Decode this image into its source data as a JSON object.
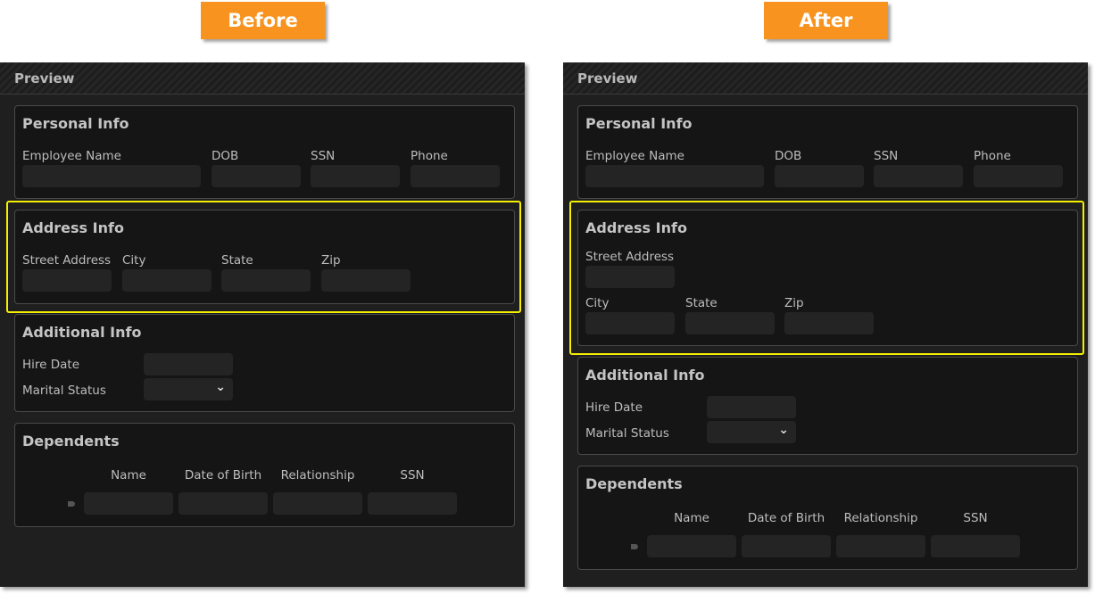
{
  "labels": {
    "before": "Before",
    "after": "After"
  },
  "colors": {
    "tag": "#f7931e",
    "highlight": "#f4f000",
    "panel": "#1f1f1f",
    "input": "#242424"
  },
  "panel": {
    "title": "Preview",
    "personal": {
      "title": "Personal Info",
      "fields": [
        "Employee Name",
        "DOB",
        "SSN",
        "Phone"
      ]
    },
    "address": {
      "title": "Address Info",
      "fields": [
        "Street Address",
        "City",
        "State",
        "Zip"
      ]
    },
    "additional": {
      "title": "Additional Info",
      "hire_date": "Hire Date",
      "marital_status": "Marital Status",
      "select_icon": "chevron-down-icon"
    },
    "dependents": {
      "title": "Dependents",
      "columns": [
        "Name",
        "Date of Birth",
        "Relationship",
        "SSN"
      ],
      "row_icon": "row-marker-icon"
    }
  }
}
